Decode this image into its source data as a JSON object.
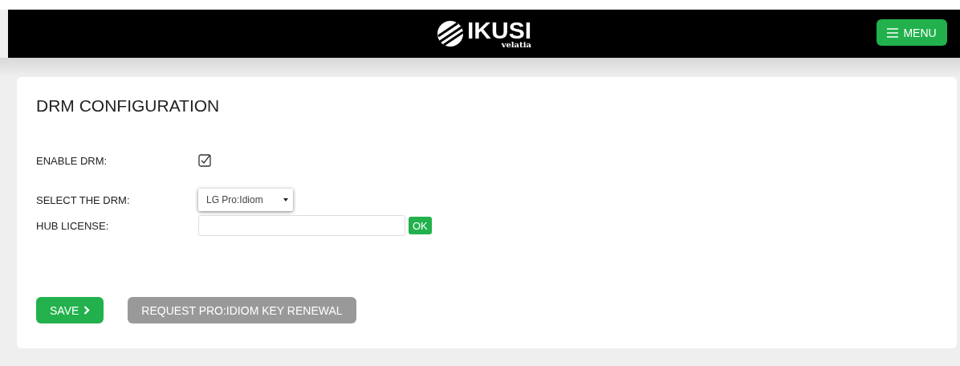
{
  "header": {
    "logo": {
      "name": "IKUSI",
      "tagline": "velatia"
    },
    "menu_button": {
      "label": "MENU"
    }
  },
  "panel": {
    "title": "DRM CONFIGURATION",
    "enable_drm": {
      "label": "ENABLE DRM:",
      "checked": true
    },
    "select_drm": {
      "label": "SELECT THE DRM:",
      "value": "LG Pro:Idiom"
    },
    "hub_license": {
      "label": "HUB LICENSE:",
      "ok_label": "OK"
    },
    "buttons": [
      {
        "label": "SAVE",
        "kind": "next",
        "disabled": false
      },
      {
        "label": "REQUEST PRO:IDIOM KEY RENEWAL",
        "kind": "plain",
        "disabled": true
      }
    ]
  }
}
